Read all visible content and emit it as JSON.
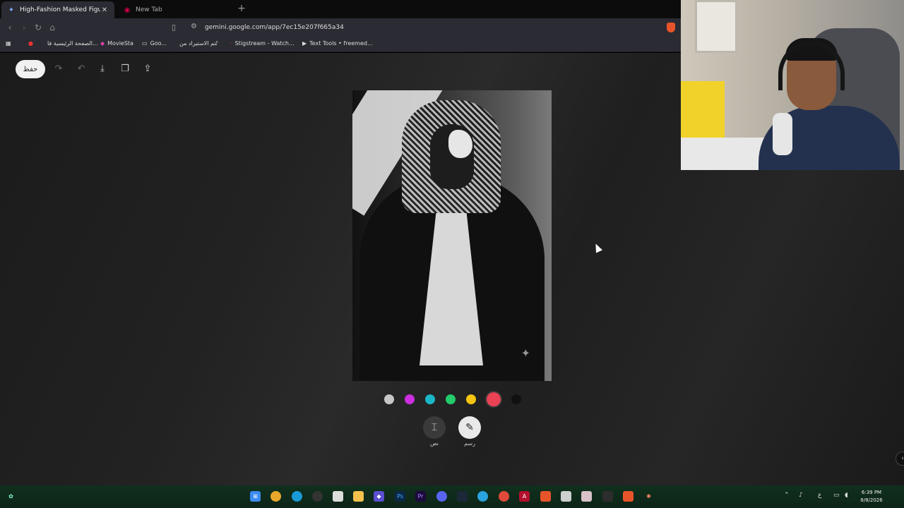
{
  "browser": {
    "tabs": [
      {
        "title": "High-Fashion Masked Figure Edi",
        "active": true
      },
      {
        "title": "New Tab",
        "active": false
      }
    ],
    "url": "gemini.google.com/app/7ec15e207f665a34",
    "bookmarks": [
      "الصفحة الرئيسية فا...",
      "MovieSta",
      "Goo...",
      "تم الاستيراد من",
      "Stigstream - Watch...",
      "Text Tools • freemed..."
    ]
  },
  "editor": {
    "save_label": "حفظ",
    "colors": [
      "#c7c7c7",
      "#cc2fe0",
      "#1ab7c7",
      "#22cc6b",
      "#f5c512",
      "#ea4255",
      "#111111"
    ],
    "selected_color_index": 5,
    "modes": {
      "text_label": "نص",
      "draw_label": "رسم"
    }
  },
  "taskbar": {
    "time": "6:39 PM",
    "date": "8/8/2026",
    "lang": "ع"
  }
}
